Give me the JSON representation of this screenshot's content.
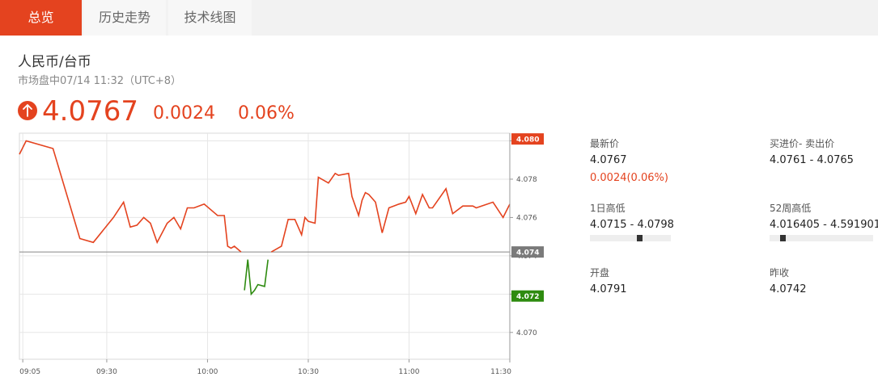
{
  "tabs": [
    {
      "label": "总览",
      "active": true
    },
    {
      "label": "历史走势",
      "active": false
    },
    {
      "label": "技术线图",
      "active": false
    }
  ],
  "pair_title": "人民币/台币",
  "market_status": "市场盘中07/14 11:32（UTC+8）",
  "quote": {
    "direction_icon": "arrow-up-icon",
    "price": "4.0767",
    "change": "0.0024",
    "change_pct": "0.06%"
  },
  "colors": {
    "accent": "#e4431f",
    "down": "#2e8b10",
    "prev_close_tag": "#7a7a7a"
  },
  "stats": {
    "latest": {
      "label": "最新价",
      "value": "4.0767",
      "change": "0.0024(0.06%)"
    },
    "bid_ask": {
      "label": "买进价- 卖出价",
      "value": "4.0761 - 4.0765"
    },
    "day_range": {
      "label": "1日高低",
      "value": "4.0715 - 4.0798",
      "position": 0.62
    },
    "week52_range": {
      "label": "52周高低",
      "value": "4.016405 - 4.591901",
      "position": 0.11
    },
    "open": {
      "label": "开盘",
      "value": "4.0791"
    },
    "prev_close": {
      "label": "昨收",
      "value": "4.0742"
    }
  },
  "chart_data": {
    "type": "line",
    "y_ticks": [
      "4.070",
      "4.072",
      "4.074",
      "4.076",
      "4.078",
      "4.080"
    ],
    "y_tick_values": [
      4.07,
      4.072,
      4.074,
      4.076,
      4.078,
      4.08
    ],
    "x_ticks": [
      "09:05",
      "09:30",
      "10:00",
      "10:30",
      "11:00",
      "11:30"
    ],
    "x_tick_minutes": [
      545,
      570,
      600,
      630,
      660,
      690
    ],
    "ylim": [
      4.0686,
      4.0804
    ],
    "xlim": [
      544,
      690
    ],
    "prev_close": 4.0742,
    "tags": [
      {
        "label": "4.080",
        "value": 4.0801,
        "kind": "last"
      },
      {
        "label": "4.074",
        "value": 4.0742,
        "kind": "prev"
      },
      {
        "label": "4.072",
        "value": 4.0719,
        "kind": "low"
      }
    ],
    "series": [
      {
        "x": [
          544,
          546,
          554,
          562,
          566,
          572,
          575,
          577,
          579,
          581,
          583,
          585,
          588,
          590,
          592,
          594,
          596,
          599,
          603,
          605,
          606,
          607,
          608,
          610,
          611,
          612,
          613,
          614,
          615,
          617,
          618,
          619,
          620,
          622,
          624,
          626,
          628,
          629,
          630,
          632,
          633,
          636,
          638,
          639,
          642,
          643,
          645,
          646,
          647,
          648,
          650,
          652,
          654,
          657,
          659,
          660,
          662,
          664,
          666,
          667,
          671,
          673,
          676,
          679,
          680,
          685,
          688,
          690
        ],
        "y": [
          4.0793,
          4.08,
          4.0796,
          4.0749,
          4.0747,
          4.076,
          4.0768,
          4.0755,
          4.0756,
          4.076,
          4.0757,
          4.0747,
          4.0757,
          4.076,
          4.0754,
          4.0765,
          4.0765,
          4.0767,
          4.0761,
          4.0761,
          4.0745,
          4.0744,
          4.0745,
          4.0742,
          4.0722,
          4.0738,
          4.072,
          4.0722,
          4.0725,
          4.0724,
          4.0738,
          4.0742,
          4.0743,
          4.0745,
          4.0759,
          4.0759,
          4.0751,
          4.076,
          4.0758,
          4.0757,
          4.0781,
          4.0778,
          4.0783,
          4.0782,
          4.0783,
          4.0771,
          4.0761,
          4.0769,
          4.0773,
          4.0772,
          4.0768,
          4.0752,
          4.0765,
          4.0767,
          4.0768,
          4.0771,
          4.0762,
          4.0772,
          4.0765,
          4.0765,
          4.0775,
          4.0762,
          4.0766,
          4.0766,
          4.0765,
          4.0768,
          4.076,
          4.0767
        ]
      }
    ]
  }
}
